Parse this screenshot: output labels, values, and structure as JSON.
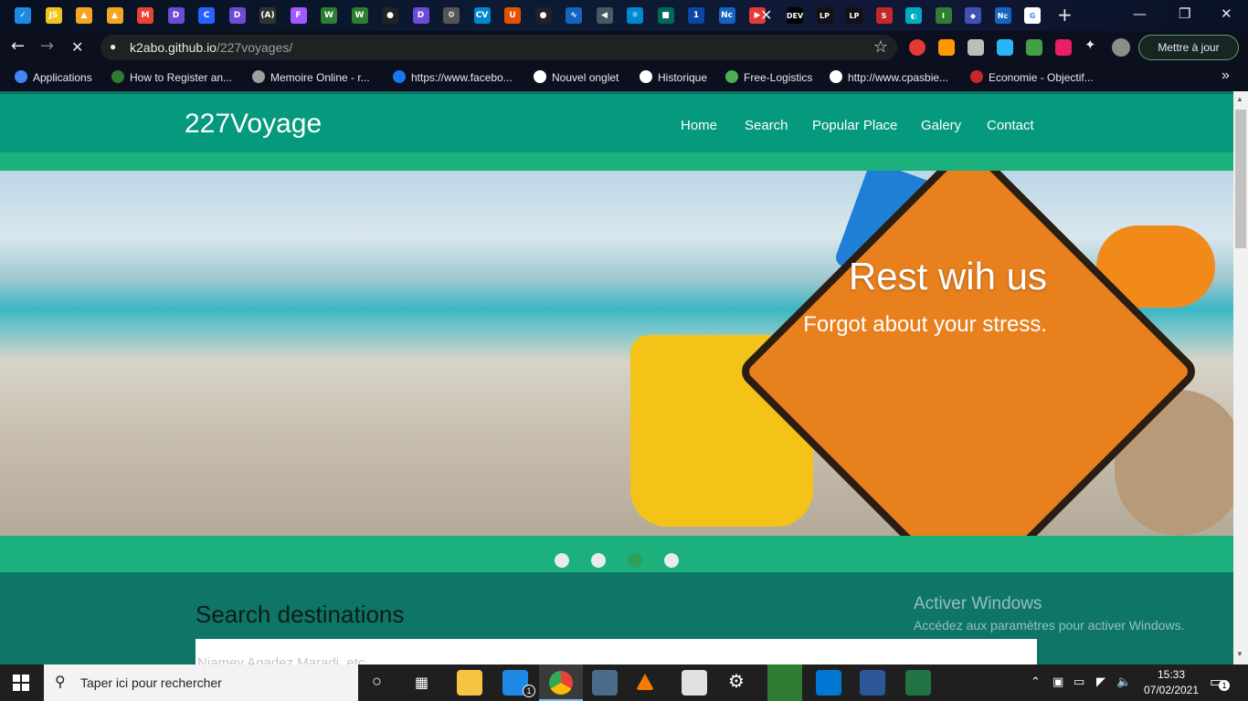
{
  "browser": {
    "tab_icons": [
      {
        "name": "swoosh-icon",
        "glyph": "✓",
        "color": "#1e88e5"
      },
      {
        "name": "js-icon",
        "glyph": "JS",
        "color": "#f0c419"
      },
      {
        "name": "firebase-icon",
        "glyph": "▲",
        "color": "#f5a623"
      },
      {
        "name": "firebase-icon-2",
        "glyph": "▲",
        "color": "#f5a623"
      },
      {
        "name": "gmail-icon",
        "glyph": "M",
        "color": "#e94235"
      },
      {
        "name": "dev-icon",
        "glyph": "D",
        "color": "#6b4cd6"
      },
      {
        "name": "c-icon",
        "glyph": "C",
        "color": "#2962ff"
      },
      {
        "name": "dev-icon-2",
        "glyph": "D",
        "color": "#6b4cd6"
      },
      {
        "name": "a-icon",
        "glyph": "(A)",
        "color": "#333333"
      },
      {
        "name": "figma-icon",
        "glyph": "F",
        "color": "#a259ff"
      },
      {
        "name": "w-icon",
        "glyph": "W",
        "color": "#2e7d32"
      },
      {
        "name": "w-icon-2",
        "glyph": "W",
        "color": "#2e7d32"
      },
      {
        "name": "github-icon",
        "glyph": "●",
        "color": "#222222"
      },
      {
        "name": "dev-icon-3",
        "glyph": "D",
        "color": "#6b4cd6"
      },
      {
        "name": "gear-icon",
        "glyph": "⚙",
        "color": "#555555"
      },
      {
        "name": "cv-icon",
        "glyph": "CV",
        "color": "#0288d1"
      },
      {
        "name": "u-icon",
        "glyph": "U",
        "color": "#e65100"
      },
      {
        "name": "github-icon-2",
        "glyph": "●",
        "color": "#222222"
      },
      {
        "name": "wave-icon",
        "glyph": "∿",
        "color": "#1565c0"
      },
      {
        "name": "arrow-icon",
        "glyph": "◀",
        "color": "#455a64"
      },
      {
        "name": "react-icon",
        "glyph": "⚛",
        "color": "#0288d1"
      },
      {
        "name": "square-icon",
        "glyph": "■",
        "color": "#00695c"
      },
      {
        "name": "one-icon",
        "glyph": "1",
        "color": "#0d47a1"
      },
      {
        "name": "nc-icon",
        "glyph": "Nc",
        "color": "#1565c0"
      },
      {
        "name": "youtube-icon",
        "glyph": "▶",
        "color": "#e53935"
      }
    ],
    "tab_close_glyph": "✕",
    "tab_icons_right": [
      {
        "name": "dev-to-icon",
        "glyph": "DEV",
        "color": "#000000"
      },
      {
        "name": "lp-icon",
        "glyph": "LP",
        "color": "#111111"
      },
      {
        "name": "lp-icon-2",
        "glyph": "LP",
        "color": "#111111"
      },
      {
        "name": "s-icon",
        "glyph": "S",
        "color": "#c62828"
      },
      {
        "name": "bracket-icon",
        "glyph": "◐",
        "color": "#00acc1"
      },
      {
        "name": "i-icon",
        "glyph": "I",
        "color": "#2e7d32"
      },
      {
        "name": "docs-icon",
        "glyph": "◆",
        "color": "#3f51b5"
      },
      {
        "name": "nc-icon-2",
        "glyph": "Nc",
        "color": "#1565c0"
      },
      {
        "name": "google-icon",
        "glyph": "G",
        "color": "#ffffff"
      }
    ],
    "new_tab_glyph": "+",
    "window_controls": {
      "minimize": "—",
      "restore": "❐",
      "close": "✕"
    },
    "nav": {
      "back": "←",
      "forward": "→",
      "stop": "✕"
    },
    "url_host": "k2abo.github.io",
    "url_path": "/227voyages/",
    "bookmark_star": "☆",
    "update_button": "Mettre à jour",
    "bookmarks": [
      {
        "label": "Applications",
        "color": "#4285f4"
      },
      {
        "label": "How to Register an...",
        "color": "#2e7d32"
      },
      {
        "label": "Memoire Online - r...",
        "color": "#9e9e9e"
      },
      {
        "label": "https://www.facebo...",
        "color": "#1877f2"
      },
      {
        "label": "Nouvel onglet",
        "color": "#ffffff"
      },
      {
        "label": "Historique",
        "color": "#ffffff"
      },
      {
        "label": "Free-Logistics",
        "color": "#4caf50"
      },
      {
        "label": "http://www.cpasbie...",
        "color": "#ffffff"
      },
      {
        "label": "Economie - Objectif...",
        "color": "#c62828"
      }
    ],
    "bookmarks_more": "»"
  },
  "site": {
    "brand": "227Voyage",
    "nav_links": [
      "Home",
      "Search",
      "Popular Place",
      "Galery",
      "Contact"
    ],
    "hero_title": "Rest wih us",
    "hero_subtitle": "Forgot about your stress.",
    "carousel": {
      "count": 4,
      "active_index": 2
    },
    "search_title": "Search destinations",
    "search_placeholder": "Niamey Agadez Maradi, etc..."
  },
  "watermark": {
    "title": "Activer Windows",
    "subtitle": "Accédez aux paramètres pour activer Windows."
  },
  "taskbar": {
    "search_placeholder": "Taper ici pour rechercher",
    "time": "15:33",
    "date": "07/02/2021",
    "mail_badge": "1",
    "notification_badge": "1"
  }
}
